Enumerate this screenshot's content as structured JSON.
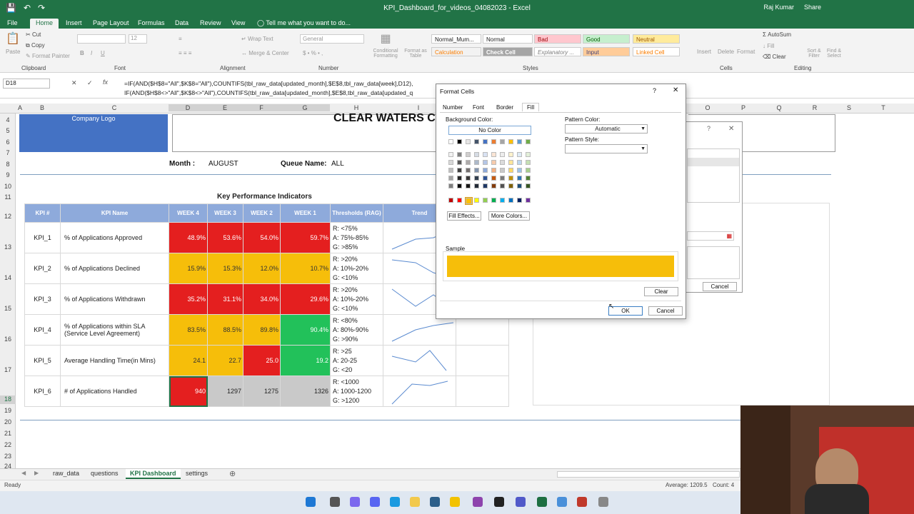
{
  "window": {
    "title": "KPI_Dashboard_for_videos_04082023 - Excel",
    "user": "Raj Kumar",
    "share": "Share"
  },
  "ribbon_tabs": [
    "File",
    "Home",
    "Insert",
    "Page Layout",
    "Formulas",
    "Data",
    "Review",
    "View",
    "Tell me what you want to do..."
  ],
  "ribbon": {
    "clipboard": {
      "paste": "Paste",
      "cut": "Cut",
      "copy": "Copy",
      "painter": "Format Painter",
      "group": "Clipboard"
    },
    "font": {
      "size": "12",
      "group": "Font"
    },
    "alignment": {
      "wrap": "Wrap Text",
      "merge": "Merge & Center",
      "group": "Alignment"
    },
    "number": {
      "format": "General",
      "group": "Number"
    },
    "styles": {
      "cond": "Conditional Formatting",
      "table": "Format as Table",
      "group": "Styles",
      "cells": [
        [
          "Normal_Mum...",
          "Normal",
          "Bad",
          "Good",
          "Neutral"
        ],
        [
          "Calculation",
          "Check Cell",
          "Explanatory ...",
          "Input",
          "Linked Cell"
        ]
      ]
    },
    "cells": {
      "insert": "Insert",
      "delete": "Delete",
      "format": "Format",
      "group": "Cells"
    },
    "editing": {
      "autosum": "AutoSum",
      "fill": "Fill",
      "clear": "Clear",
      "sort": "Sort & Filter",
      "find": "Find & Select",
      "group": "Editing"
    }
  },
  "formula_bar": {
    "cell": "D18",
    "line1": "=IF(AND($H$8=\"All\",$K$8=\"All\"),COUNTIFS(tbl_raw_data[updated_month],$E$8,tbl_raw_data[week],D12),",
    "line2": "IF(AND($H$8<>\"All\",$K$8<>\"All\"),COUNTIFS(tbl_raw_data[updated_month],$E$8,tbl_raw_data[updated_q"
  },
  "columns": [
    "A",
    "B",
    "C",
    "D",
    "E",
    "F",
    "G",
    "H",
    "I",
    "O",
    "P",
    "Q",
    "R",
    "S",
    "T"
  ],
  "rows": [
    "4",
    "5",
    "6",
    "7",
    "8",
    "9",
    "10",
    "11",
    "12",
    "13",
    "14",
    "15",
    "16",
    "17",
    "18",
    "19",
    "20",
    "21",
    "22",
    "23",
    "24"
  ],
  "sheet": {
    "logo": "Company Logo",
    "banner": "CLEAR WATERS C",
    "month_label": "Month :",
    "month": "AUGUST",
    "queue_label": "Queue Name:",
    "queue": "ALL",
    "kpi_title": "Key Performance Indicators",
    "headers": [
      "KPI #",
      "KPI Name",
      "WEEK 4",
      "WEEK 3",
      "WEEK 2",
      "WEEK 1",
      "Thresholds (RAG)",
      "Trend"
    ],
    "rows": [
      {
        "id": "KPI_1",
        "name": "% of Applications Approved",
        "vals": [
          "48.9%",
          "53.6%",
          "54.0%",
          "59.7%"
        ],
        "cls": [
          "red",
          "red",
          "red",
          "red"
        ],
        "th": [
          "R: <75%",
          "A: 75%-85%",
          "G: >85%"
        ]
      },
      {
        "id": "KPI_2",
        "name": "% of Applications Declined",
        "vals": [
          "15.9%",
          "15.3%",
          "12.0%",
          "10.7%"
        ],
        "cls": [
          "amb",
          "amb",
          "amb",
          "amb"
        ],
        "th": [
          "R: >20%",
          "A: 10%-20%",
          "G: <10%"
        ]
      },
      {
        "id": "KPI_3",
        "name": "% of Applications Withdrawn",
        "vals": [
          "35.2%",
          "31.1%",
          "34.0%",
          "29.6%"
        ],
        "cls": [
          "red",
          "red",
          "red",
          "red"
        ],
        "th": [
          "R: >20%",
          "A: 10%-20%",
          "G: <10%"
        ]
      },
      {
        "id": "KPI_4",
        "name": "% of Applications within SLA (Service Level Agreement)",
        "vals": [
          "83.5%",
          "88.5%",
          "89.8%",
          "90.4%"
        ],
        "cls": [
          "amb",
          "amb",
          "amb",
          "grn"
        ],
        "th": [
          "R: <80%",
          "A: 80%-90%",
          "G: >90%"
        ]
      },
      {
        "id": "KPI_5",
        "name": "Average Handling Time(in Mins)",
        "vals": [
          "24.1",
          "22.7",
          "25.0",
          "19.2"
        ],
        "cls": [
          "amb",
          "amb",
          "red",
          "grn"
        ],
        "th": [
          "R: >25",
          "A: 20-25",
          "G: <20"
        ]
      },
      {
        "id": "KPI_6",
        "name": "# of Applications Handled",
        "vals": [
          "940",
          "1297",
          "1275",
          "1326"
        ],
        "cls": [
          "red",
          "gry",
          "gry",
          "gry"
        ],
        "th": [
          "R: <1000",
          "A: 1000-1200",
          "G: >1200"
        ]
      }
    ]
  },
  "dialog": {
    "title": "Format Cells",
    "help": "?",
    "close": "✕",
    "tabs": [
      "Number",
      "Font",
      "Border",
      "Fill"
    ],
    "bg_label": "Background Color:",
    "no_color": "No Color",
    "fill_effects": "Fill Effects...",
    "more_colors": "More Colors...",
    "pattern_color_label": "Pattern Color:",
    "pattern_color": "Automatic",
    "pattern_style_label": "Pattern Style:",
    "sample_label": "Sample",
    "sample_color": "#f6be0a",
    "clear": "Clear",
    "ok": "OK",
    "cancel": "Cancel"
  },
  "bg_dialog": {
    "cancel": "Cancel",
    "help": "?",
    "close": "✕"
  },
  "sheet_tabs": [
    "raw_data",
    "questions",
    "KPI Dashboard",
    "settings"
  ],
  "status": {
    "ready": "Ready",
    "average": "Average: 1209.5",
    "count": "Count: 4"
  }
}
